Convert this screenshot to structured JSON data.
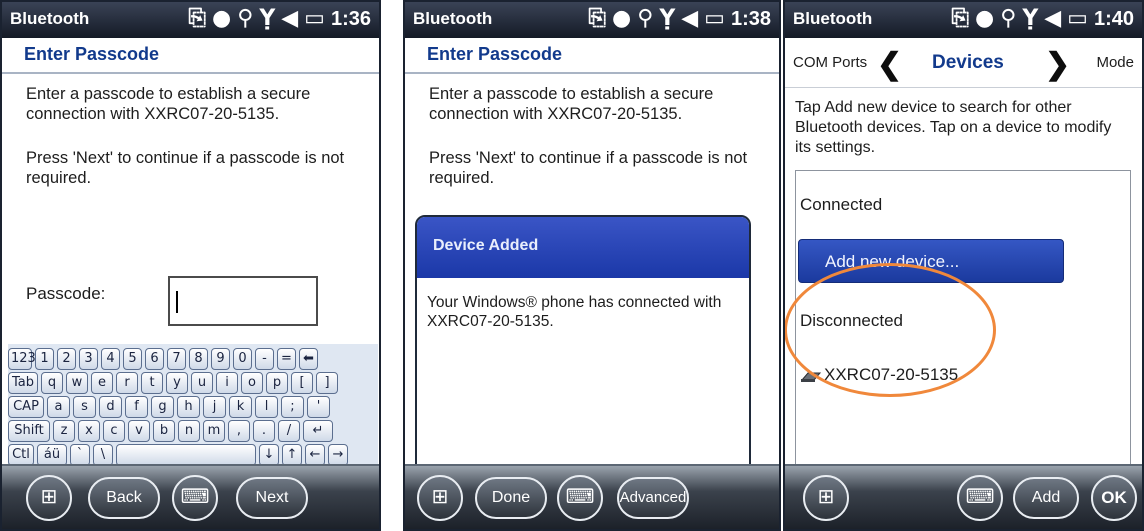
{
  "screens": [
    {
      "status": {
        "title": "Bluetooth",
        "time": "1:36"
      },
      "heading": "Enter Passcode",
      "paragraph1": "Enter a passcode to establish a secure connection with XXRC07-20-5135.",
      "paragraph2": "Press 'Next' to continue if a passcode is not required.",
      "passcode_label": "Passcode:",
      "passcode_value": "",
      "keyboard": {
        "row1": [
          "123",
          "1",
          "2",
          "3",
          "4",
          "5",
          "6",
          "7",
          "8",
          "9",
          "0",
          "-",
          "=",
          "⬅"
        ],
        "row2": [
          "Tab",
          "q",
          "w",
          "e",
          "r",
          "t",
          "y",
          "u",
          "i",
          "o",
          "p",
          "[",
          "]"
        ],
        "row3": [
          "CAP",
          "a",
          "s",
          "d",
          "f",
          "g",
          "h",
          "j",
          "k",
          "l",
          ";",
          "'"
        ],
        "row4": [
          "Shift",
          "z",
          "x",
          "c",
          "v",
          "b",
          "n",
          "m",
          ",",
          ".",
          "/",
          "↵"
        ],
        "row5": [
          "Ctl",
          "áü",
          "`",
          "\\",
          "",
          "↓",
          "↑",
          "←",
          "→"
        ]
      },
      "buttons": {
        "start": "start-icon",
        "back": "Back",
        "keyboard": "keyboard-icon",
        "next": "Next"
      }
    },
    {
      "status": {
        "title": "Bluetooth",
        "time": "1:38"
      },
      "heading": "Enter Passcode",
      "paragraph1": "Enter a passcode to establish a secure connection with XXRC07-20-5135.",
      "paragraph2": "Press 'Next' to continue if a passcode is not required.",
      "dialog": {
        "title": "Device Added",
        "message": "Your Windows® phone has connected with XXRC07-20-5135."
      },
      "buttons": {
        "start": "start-icon",
        "done": "Done",
        "keyboard": "keyboard-icon",
        "advanced": "Advanced"
      }
    },
    {
      "status": {
        "title": "Bluetooth",
        "time": "1:40"
      },
      "tabs": {
        "left": "COM Ports",
        "center": "Devices",
        "right": "Mode"
      },
      "paragraph1": "Tap Add new device to search for other Bluetooth devices. Tap on a device to modify its settings.",
      "connected_label": "Connected",
      "add_new_device": "Add new device...",
      "disconnected_label": "Disconnected",
      "device_name": "XXRC07-20-5135",
      "buttons": {
        "start": "start-icon",
        "keyboard": "keyboard-icon",
        "add": "Add",
        "ok": "OK"
      }
    }
  ],
  "colors": {
    "heading_blue": "#123a8c",
    "dialog_blue": "#1b38a8",
    "highlight_orange": "#f0883b"
  }
}
